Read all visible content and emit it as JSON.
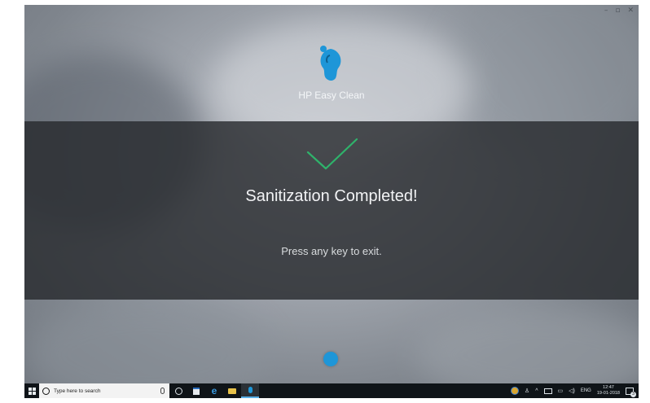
{
  "app": {
    "title": "HP Easy Clean"
  },
  "window_controls": {
    "minimize_icon": "minimize-icon",
    "restore_icon": "restore-icon",
    "close_icon": "close-icon"
  },
  "status": {
    "title": "Sanitization Completed!",
    "hint": "Press any key to exit.",
    "check_color": "#2fb36b"
  },
  "colors": {
    "accent": "#1e96d8",
    "overlay": "#26282c"
  },
  "taskbar": {
    "search_placeholder": "Type here to search",
    "pinned": [
      "task-view-icon",
      "store-icon",
      "edge-icon",
      "file-explorer-icon",
      "hp-easy-clean-icon"
    ],
    "language": "ENG",
    "time": "12:47",
    "date": "19-01-2018",
    "notification_count": "3"
  }
}
